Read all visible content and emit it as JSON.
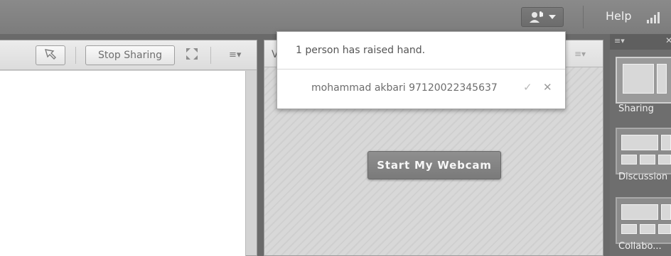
{
  "header": {
    "help_label": "Help",
    "raise_hand_icon": "raised-hand-icon",
    "dropdown_icon": "chevron-down-icon",
    "status_icon": "signal-bars-icon"
  },
  "share_pod": {
    "pointer_icon": "pointer-tool-icon",
    "stop_sharing_label": "Stop Sharing",
    "fullscreen_icon": "fullscreen-icon",
    "menu_glyph": "≡▾"
  },
  "video_pod": {
    "title_partial": "V",
    "menu_glyph": "≡▾",
    "start_webcam_label": "Start My Webcam"
  },
  "raised_hand_popup": {
    "title": "1 person has raised hand.",
    "entries": [
      {
        "name": "mohammad akbari 97120022345637",
        "accept_glyph": "✓",
        "dismiss_glyph": "✕"
      }
    ]
  },
  "layouts_panel": {
    "menu_glyph": "≡▾",
    "close_glyph": "✕",
    "items": [
      {
        "label": "Sharing",
        "selected": true
      },
      {
        "label": "Discussion",
        "selected": false
      },
      {
        "label": "Collabo...",
        "selected": false
      }
    ]
  },
  "colors": {
    "topbar": "#7f7f7f",
    "panel_bg": "#6e6e6e",
    "button_grey": "#858585"
  }
}
